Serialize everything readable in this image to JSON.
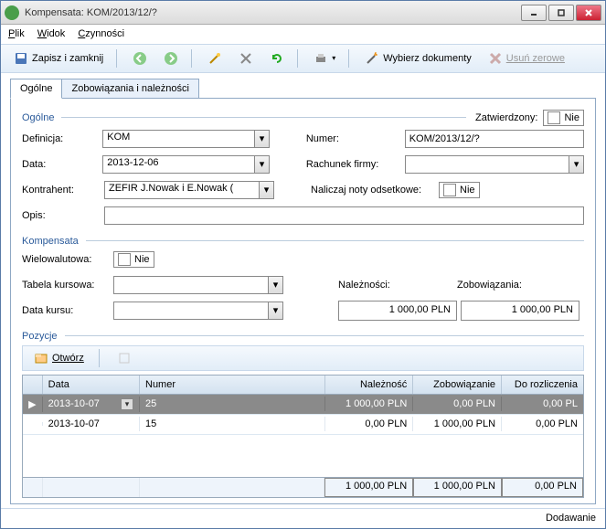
{
  "window": {
    "title": "Kompensata: KOM/2013/12/?"
  },
  "menu": {
    "plik": "Plik",
    "widok": "Widok",
    "czynnosci": "Czynności"
  },
  "toolbar": {
    "save_close": "Zapisz i zamknij",
    "wybierz": "Wybierz dokumenty",
    "usun": "Usuń zerowe"
  },
  "tabs": {
    "ogolne": "Ogólne",
    "zob": "Zobowiązania i należności"
  },
  "ogolne": {
    "title": "Ogólne",
    "zatwierdzony_lbl": "Zatwierdzony:",
    "zatwierdzony_val": "Nie",
    "definicja_lbl": "Definicja:",
    "definicja_val": "KOM",
    "numer_lbl": "Numer:",
    "numer_val": "KOM/2013/12/?",
    "data_lbl": "Data:",
    "data_val": "2013-12-06",
    "rachunek_lbl": "Rachunek firmy:",
    "rachunek_val": "",
    "kontrahent_lbl": "Kontrahent:",
    "kontrahent_val": "ZEFIR J.Nowak i E.Nowak (",
    "noty_lbl": "Naliczaj noty odsetkowe:",
    "noty_val": "Nie",
    "opis_lbl": "Opis:",
    "opis_val": ""
  },
  "kompensata": {
    "title": "Kompensata",
    "wielo_lbl": "Wielowalutowa:",
    "wielo_val": "Nie",
    "tabela_lbl": "Tabela kursowa:",
    "tabela_val": "",
    "datakursu_lbl": "Data kursu:",
    "datakursu_val": "",
    "nal_lbl": "Należności:",
    "nal_val": "1 000,00 PLN",
    "zob_lbl": "Zobowiązania:",
    "zob_val": "1 000,00 PLN"
  },
  "pozycje": {
    "title": "Pozycje",
    "otworz": "Otwórz",
    "cols": {
      "data": "Data",
      "numer": "Numer",
      "nal": "Należność",
      "zob": "Zobowiązanie",
      "dor": "Do rozliczenia"
    },
    "rows": [
      {
        "data": "2013-10-07",
        "numer": "25",
        "nal": "1 000,00 PLN",
        "zob": "0,00 PLN",
        "dor": "0,00 PL"
      },
      {
        "data": "2013-10-07",
        "numer": "15",
        "nal": "0,00 PLN",
        "zob": "1 000,00 PLN",
        "dor": "0,00 PLN"
      }
    ],
    "totals": {
      "nal": "1 000,00 PLN",
      "zob": "1 000,00 PLN",
      "dor": "0,00 PLN"
    }
  },
  "status": {
    "text": "Dodawanie"
  }
}
